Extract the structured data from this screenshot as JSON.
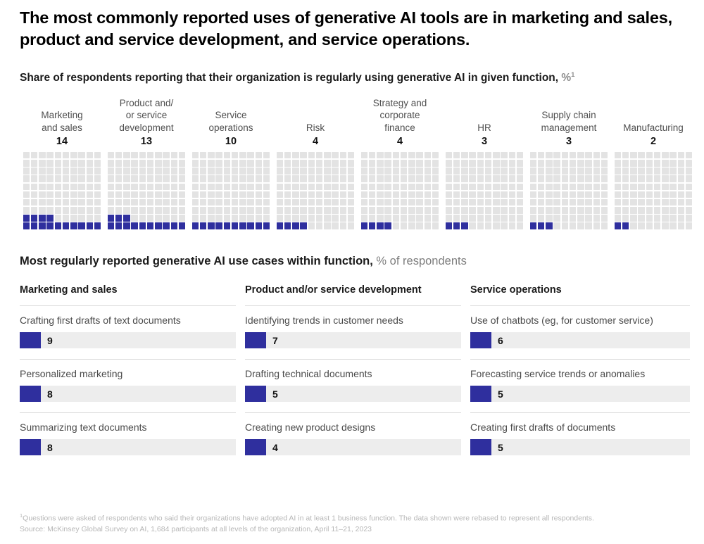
{
  "headline": "The most commonly reported uses of generative AI tools are in marketing and sales, product and service development, and service operations.",
  "subtitle": {
    "text": "Share of respondents reporting that their organization is regularly using generative AI in given function, ",
    "unit": "%",
    "footnote_marker": "1"
  },
  "usecases_title": {
    "bold": "Most regularly reported generative AI use cases within function,",
    "light": " % of respondents"
  },
  "colors": {
    "accent": "#2f2f9e",
    "empty_cell": "#e3e3e3",
    "track": "#ededed",
    "label": "#4f4f4f",
    "footnote": "#b7b7b7"
  },
  "chart_data": [
    {
      "type": "bar",
      "subtype": "waffle",
      "title": "Share of respondents reporting that their organization is regularly using generative AI in given function, %",
      "xlabel": "",
      "ylabel": "",
      "unit": "%",
      "grid_rows": 10,
      "grid_cols": 10,
      "total_cells": 100,
      "categories": [
        "Marketing and sales",
        "Product and/or service development",
        "Service operations",
        "Risk",
        "Strategy and corporate finance",
        "HR",
        "Supply chain management",
        "Manufacturing"
      ],
      "values": [
        14,
        13,
        10,
        4,
        4,
        3,
        3,
        2
      ],
      "label_lines": [
        [
          "Marketing",
          "and sales"
        ],
        [
          "Product and/",
          "or service",
          "development"
        ],
        [
          "Service",
          "operations"
        ],
        [
          "Risk"
        ],
        [
          "Strategy and",
          "corporate",
          "finance"
        ],
        [
          "HR"
        ],
        [
          "Supply chain",
          "management"
        ],
        [
          "Manufacturing"
        ]
      ]
    },
    {
      "type": "bar",
      "title": "Most regularly reported generative AI use cases within function, % of respondents",
      "xlabel": "",
      "ylabel": "",
      "unit": "% of respondents",
      "xlim": [
        0,
        100
      ],
      "groups": [
        {
          "name": "Marketing and sales",
          "categories": [
            "Crafting first drafts of text documents",
            "Personalized marketing",
            "Summarizing text documents"
          ],
          "values": [
            9,
            8,
            8
          ]
        },
        {
          "name": "Product and/or service development",
          "categories": [
            "Identifying trends in customer needs",
            "Drafting technical documents",
            "Creating new product designs"
          ],
          "values": [
            7,
            5,
            4
          ]
        },
        {
          "name": "Service operations",
          "categories": [
            "Use of chatbots (eg, for customer service)",
            "Forecasting service trends or anomalies",
            "Creating first drafts of documents"
          ],
          "values": [
            6,
            5,
            5
          ]
        }
      ]
    }
  ],
  "footnotes": [
    {
      "marker": "1",
      "text": "Questions were asked of respondents who said their organizations have adopted AI in at least 1 business function. The data shown were rebased to represent all respondents."
    },
    {
      "marker": "",
      "text": "Source: McKinsey Global Survey on AI, 1,684 participants at all levels of the organization, April 11–21, 2023"
    }
  ]
}
